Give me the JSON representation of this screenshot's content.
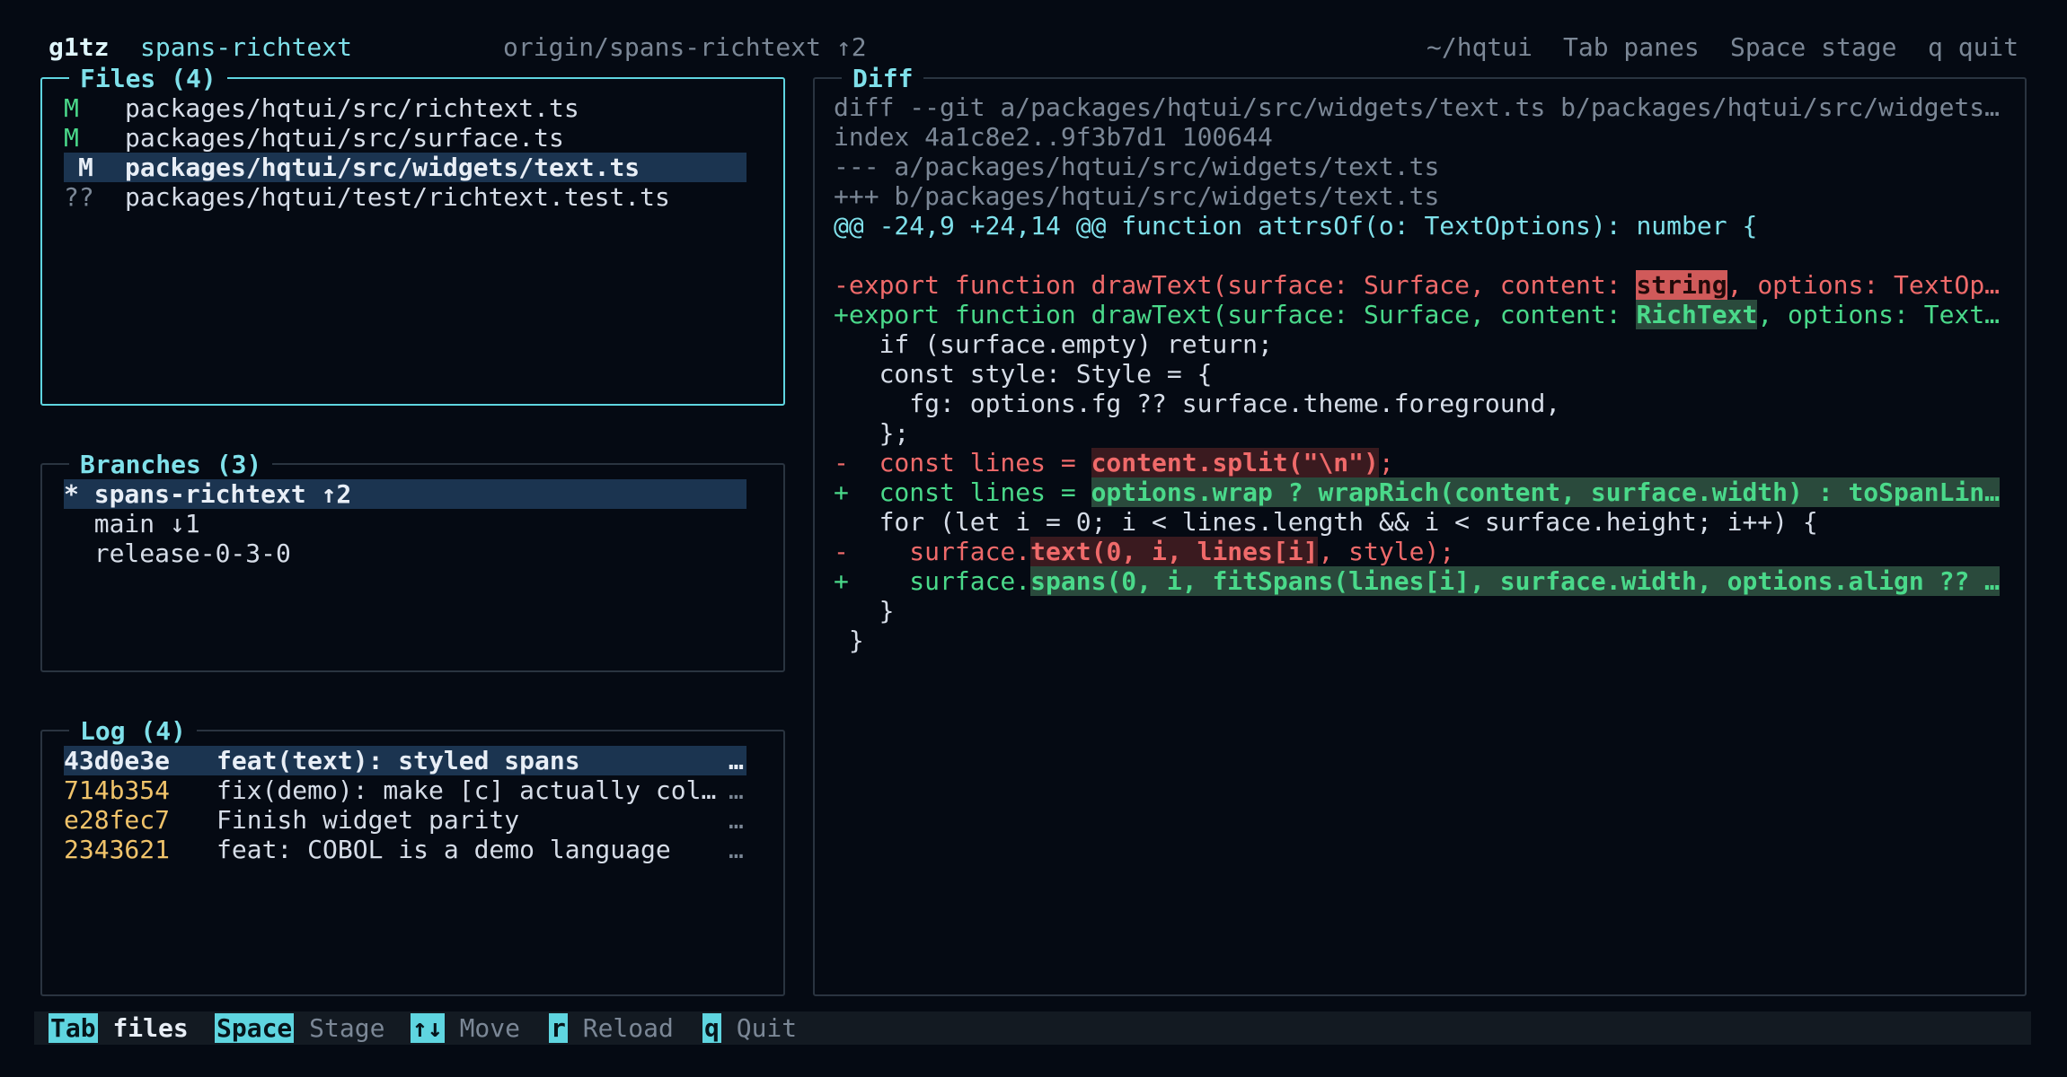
{
  "header": {
    "app": "g1tz",
    "branch": "spans-richtext",
    "remote": "origin/spans-richtext ↑2",
    "path": "~/hqtui",
    "hint_tab": "Tab panes",
    "hint_space": "Space stage",
    "hint_quit": "q quit"
  },
  "files": {
    "title": "Files (4)",
    "items": [
      {
        "status": "M",
        "path": "packages/hqtui/src/richtext.ts"
      },
      {
        "status": "M",
        "path": "packages/hqtui/src/surface.ts"
      },
      {
        "status": "M",
        "path": "packages/hqtui/src/widgets/text.ts"
      },
      {
        "status": "??",
        "path": "packages/hqtui/test/richtext.test.ts"
      }
    ]
  },
  "branches": {
    "title": "Branches (3)",
    "items": [
      {
        "label": "* spans-richtext ↑2"
      },
      {
        "label": "  main ↓1"
      },
      {
        "label": "  release-0-3-0"
      }
    ]
  },
  "log": {
    "title": "Log (4)",
    "items": [
      {
        "hash": "43d0e3e",
        "msg": "feat(text): styled spans",
        "more": "…"
      },
      {
        "hash": "714b354",
        "msg": "fix(demo): make [c] actually col…",
        "more": "…"
      },
      {
        "hash": "e28fec7",
        "msg": "Finish widget parity",
        "more": "…"
      },
      {
        "hash": "2343621",
        "msg": "feat: COBOL is a demo language",
        "more": "…"
      }
    ]
  },
  "diff": {
    "title": "Diff",
    "meta1": "diff --git a/packages/hqtui/src/widgets/text.ts b/packages/hqtui/src/widgets…",
    "meta2": "index 4a1c8e2..9f3b7d1 100644",
    "meta3": "--- a/packages/hqtui/src/widgets/text.ts",
    "meta4": "+++ b/packages/hqtui/src/widgets/text.ts",
    "hunk": "@@ -24,9 +24,14 @@ function attrsOf(o: TextOptions): number {",
    "l1a": "-export function drawText(surface: Surface, content: ",
    "l1b": "string",
    "l1c": ", options: TextOp…",
    "l2a": "+export function drawText(surface: Surface, content: ",
    "l2b": "RichText",
    "l2c": ", options: Text…",
    "l3": "   if (surface.empty) return;",
    "l4": "   const style: Style = {",
    "l5": "     fg: options.fg ?? surface.theme.foreground,",
    "l6": "   };",
    "l7a": "-  const lines = ",
    "l7b": "content.split(\"\\n\")",
    "l7c": ";",
    "l8a": "+  const lines = ",
    "l8b": "options.wrap ? wrapRich(content, surface.width) : toSpanLin…",
    "l9": "   for (let i = 0; i < lines.length && i < surface.height; i++) {",
    "l10a": "-    surface.",
    "l10b": "text(0, i, lines[i]",
    "l10c": ", style);",
    "l11a": "+    surface.",
    "l11b": "spans(0, i, fitSpans(lines[i], surface.width, options.align ?? …",
    "l12": "   }",
    "l13": " }"
  },
  "footer": {
    "k1": "Tab",
    "l1": "files",
    "k2": "Space",
    "l2": "Stage",
    "k3": "↑↓",
    "l3": "Move",
    "k4": "r",
    "l4": "Reload",
    "k5": "q",
    "l5": "Quit"
  },
  "colors": {
    "background": "#050a13",
    "accent": "#5fd5e0",
    "added": "#4ad98a",
    "removed": "#ef6a6a",
    "hash": "#f0c36a",
    "selection": "#1b3450"
  }
}
